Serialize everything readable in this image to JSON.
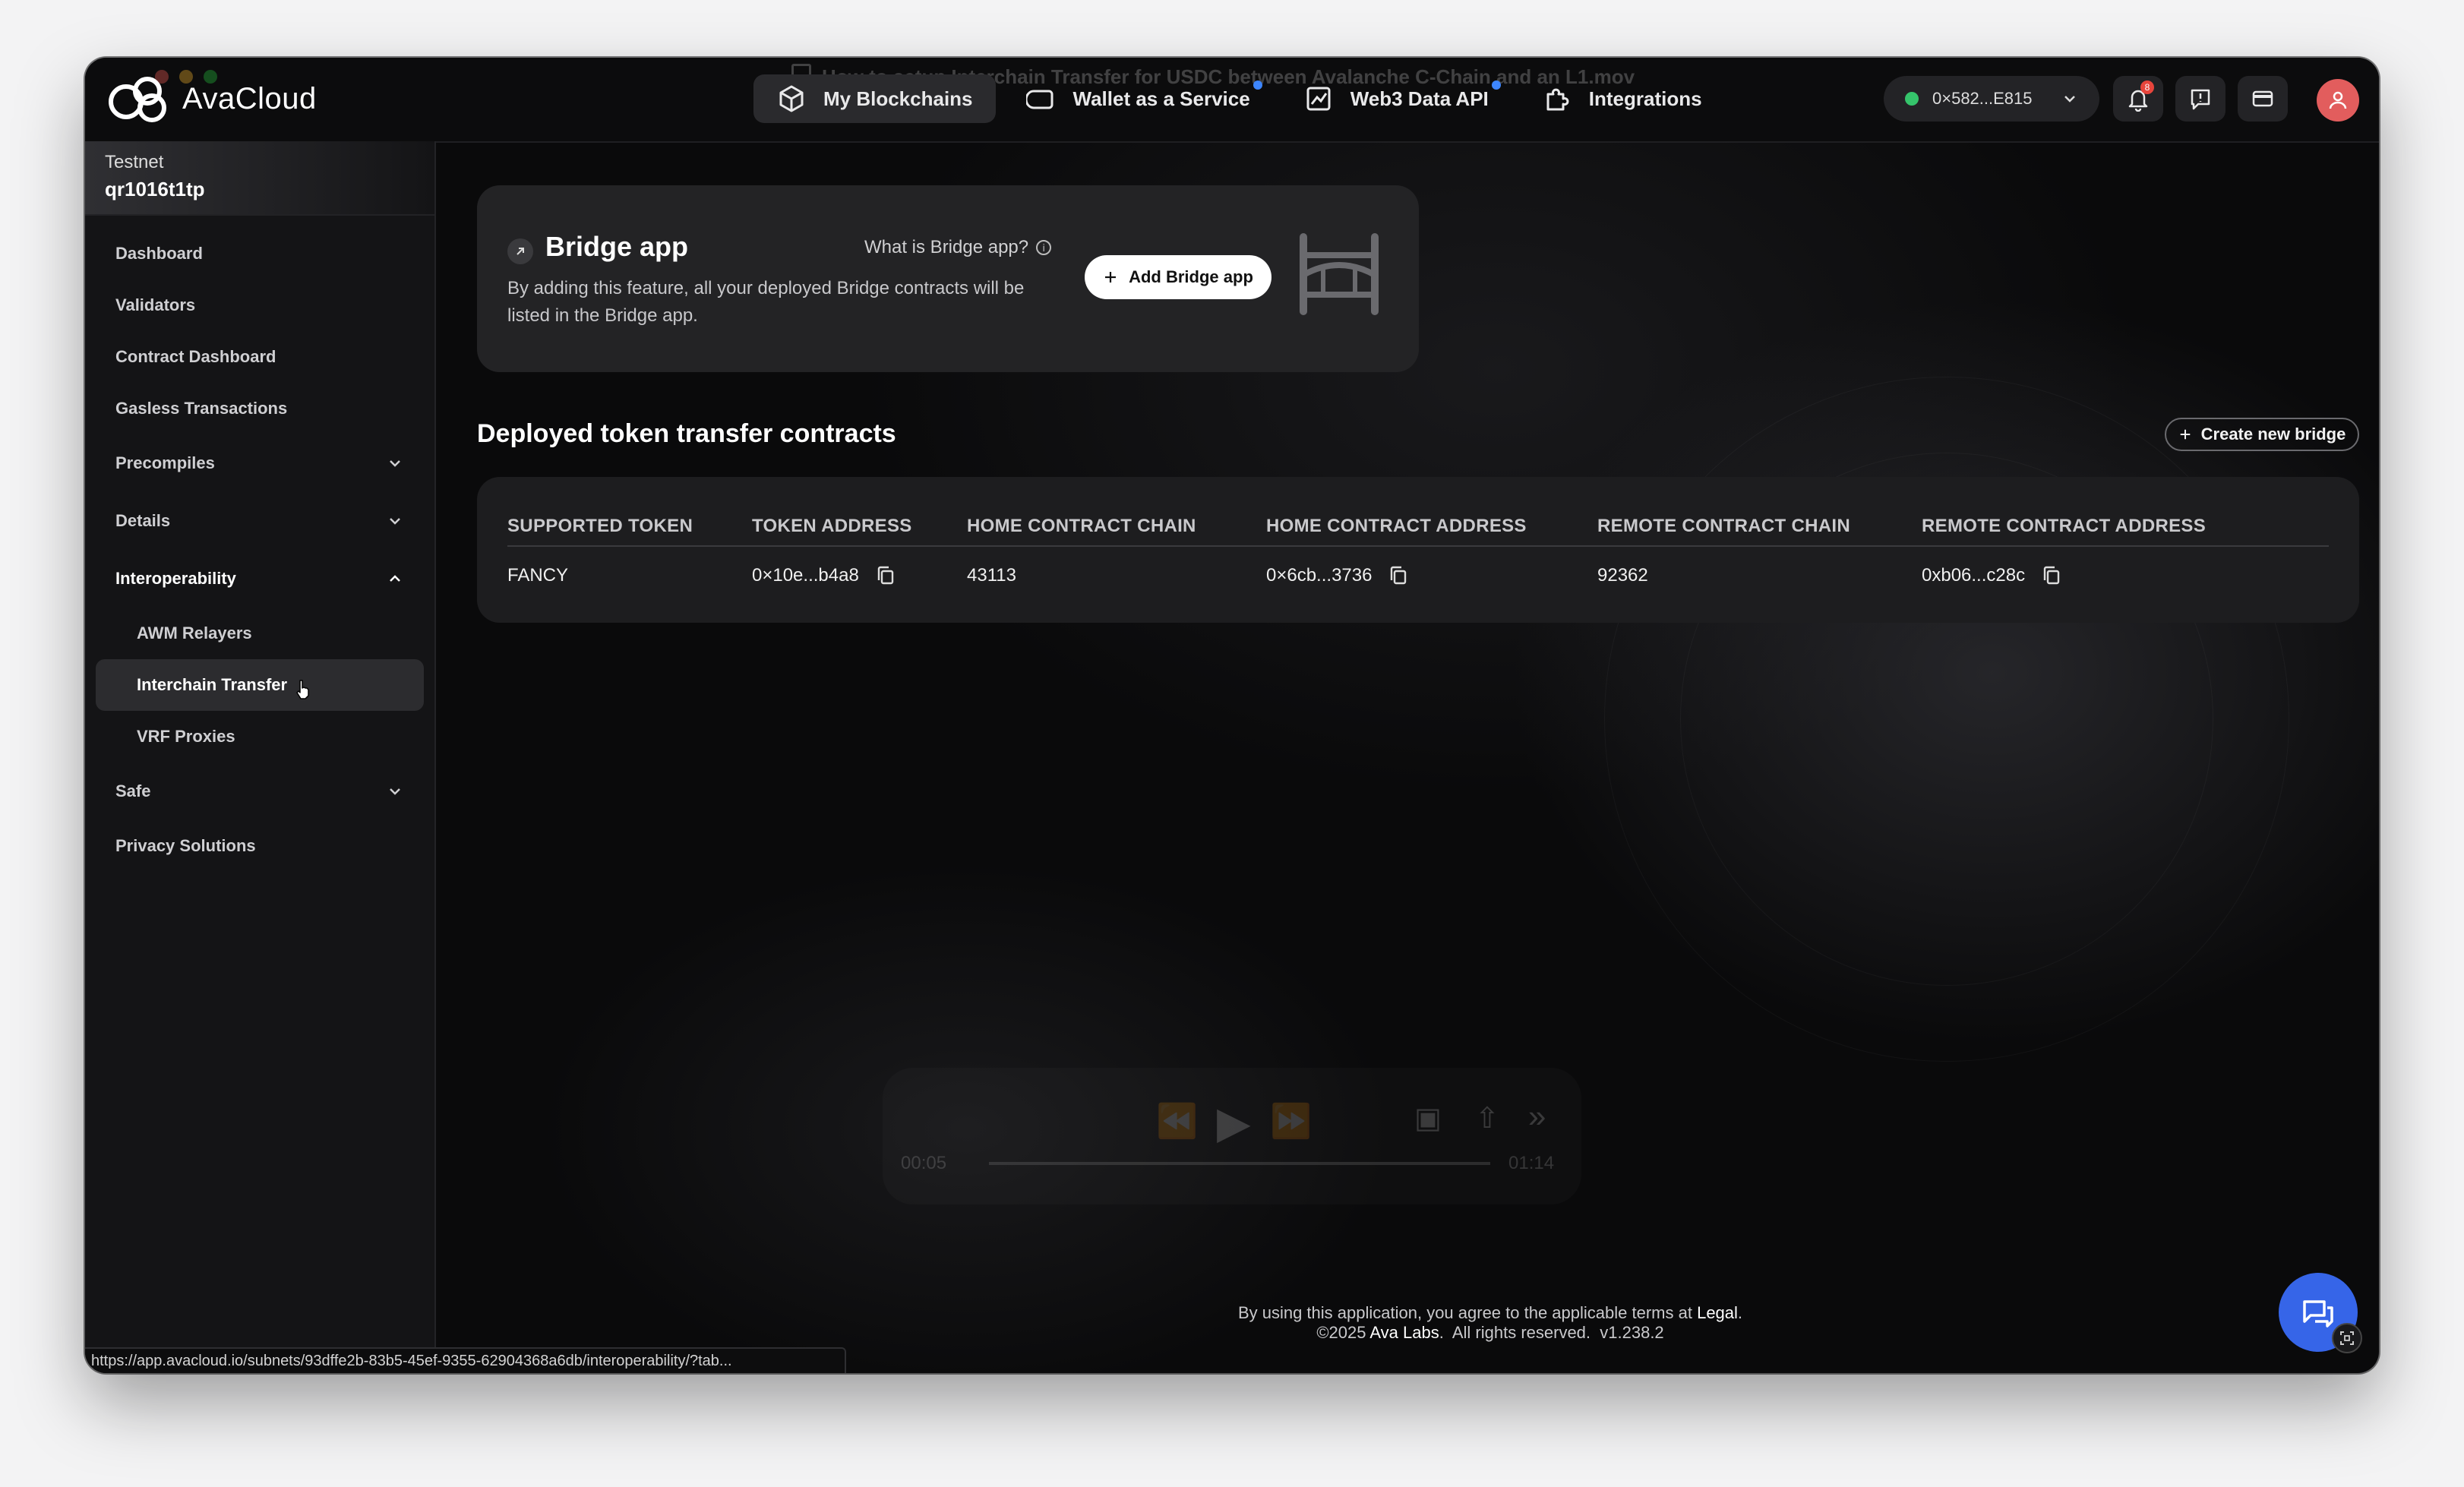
{
  "app": {
    "name": "AvaCloud",
    "video_title": "How to setup Interchain Transfer for USDC between Avalanche C-Chain and an L1.mov"
  },
  "nav": {
    "items": [
      {
        "label": "My Blockchains",
        "icon": "cube-icon",
        "active": true
      },
      {
        "label": "Wallet as a Service",
        "icon": "wallet-icon",
        "dot": true
      },
      {
        "label": "Web3 Data API",
        "icon": "chart-icon",
        "dot": true
      },
      {
        "label": "Integrations",
        "icon": "puzzle-icon"
      }
    ]
  },
  "header": {
    "wallet_address": "0×582...E815",
    "notification_count": "8"
  },
  "sidebar": {
    "network_label": "Testnet",
    "network_name": "qr1016t1tp",
    "items": [
      {
        "label": "Dashboard"
      },
      {
        "label": "Validators"
      },
      {
        "label": "Contract Dashboard"
      },
      {
        "label": "Gasless Transactions"
      },
      {
        "label": "Precompiles",
        "expandable": true
      },
      {
        "label": "Details",
        "expandable": true
      },
      {
        "label": "Interoperability",
        "expanded": true
      },
      {
        "label": "AWM Relayers",
        "sub": true
      },
      {
        "label": "Interchain Transfer",
        "sub": true,
        "active": true
      },
      {
        "label": "VRF Proxies",
        "sub": true
      },
      {
        "label": "Safe",
        "expandable": true
      },
      {
        "label": "Privacy Solutions"
      }
    ]
  },
  "bridge_card": {
    "title": "Bridge app",
    "description": "By adding this feature, all your deployed Bridge contracts will be listed in the Bridge app.",
    "what_is": "What is Bridge app?",
    "add_button": "Add Bridge app"
  },
  "contracts": {
    "title": "Deployed token transfer contracts",
    "create_button": "Create new bridge",
    "columns": [
      "SUPPORTED TOKEN",
      "TOKEN ADDRESS",
      "HOME CONTRACT CHAIN",
      "HOME CONTRACT ADDRESS",
      "REMOTE CONTRACT CHAIN",
      "REMOTE CONTRACT ADDRESS"
    ],
    "rows": [
      {
        "token": "FANCY",
        "token_address": "0×10e...b4a8",
        "home_chain": "43113",
        "home_address": "0×6cb...3736",
        "remote_chain": "92362",
        "remote_address": "0xb06...c28c"
      }
    ]
  },
  "video": {
    "current_time": "00:05",
    "end_time": "01:14"
  },
  "footer": {
    "line1_prefix": "By using this application, you agree to the applicable terms at ",
    "line1_link": "Legal",
    "line1_suffix": ".",
    "line2_prefix": "©2025 ",
    "line2_company": "Ava Labs",
    "line2_suffix": ".  All rights reserved.  v1.238.2"
  },
  "status_url": "https://app.avacloud.io/subnets/93dffe2b-83b5-45ef-9355-62904368a6db/interoperability/?tab...",
  "colors": {
    "accent_blue": "#3665e8",
    "status_green": "#35c46b",
    "badge_red": "#e8453c"
  }
}
